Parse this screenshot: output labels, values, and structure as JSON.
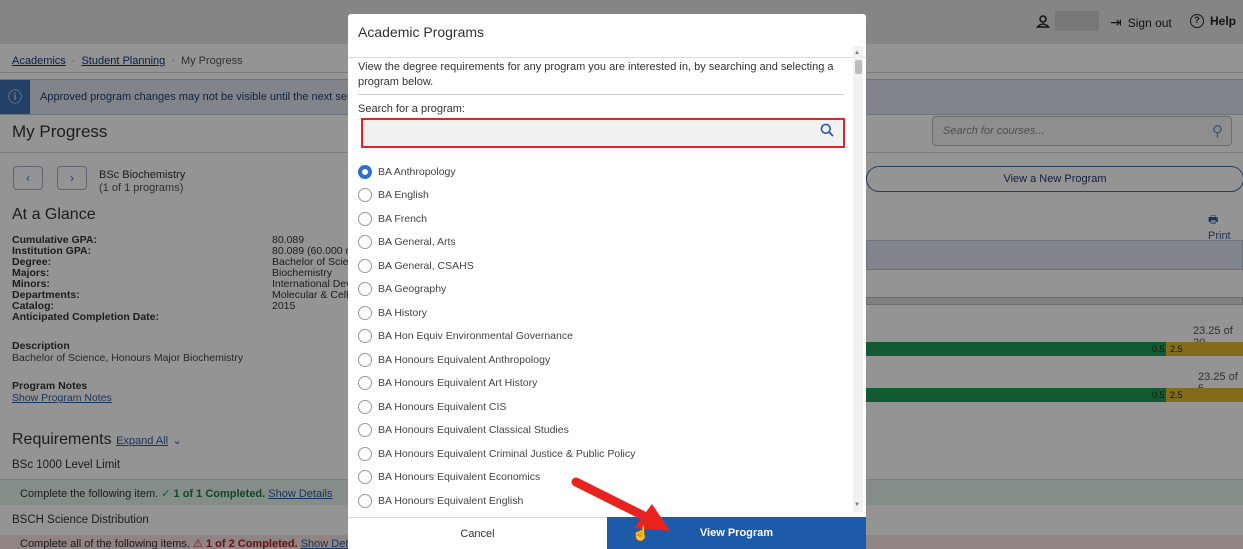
{
  "header": {
    "sign_out": "Sign out",
    "help": "Help"
  },
  "breadcrumb": {
    "items": [
      "Academics",
      "Student Planning",
      "My Progress"
    ]
  },
  "info_banner": {
    "text": "Approved program changes may not be visible until the next sem"
  },
  "page": {
    "title": "My Progress",
    "course_search_placeholder": "Search for courses...",
    "program_name": "BSc Biochemistry",
    "program_count": "(1 of 1 programs)",
    "view_new_program": "View a New Program",
    "print": "Print"
  },
  "glance": {
    "title": "At a Glance",
    "rows": [
      {
        "label": "Cumulative GPA:",
        "value": "80.089"
      },
      {
        "label": "Institution GPA:",
        "value": "80.089 (60.000 re"
      },
      {
        "label": "Degree:",
        "value": "Bachelor of Scien"
      },
      {
        "label": "Majors:",
        "value": "Biochemistry"
      },
      {
        "label": "Minors:",
        "value": "International Dev"
      },
      {
        "label": "Departments:",
        "value": "Molecular & Cellu"
      },
      {
        "label": "Catalog:",
        "value": "2015"
      },
      {
        "label": "Anticipated Completion Date:",
        "value": ""
      }
    ],
    "description_label": "Description",
    "description_value": "Bachelor of Science, Honours Major Biochemistry",
    "notes_label": "Program Notes",
    "notes_link": "Show Program Notes"
  },
  "progress": {
    "bar1_label": "23.25 of 20",
    "bar2_label": "23.25 of 5",
    "seg_a": "0.5",
    "seg_b": "2.5"
  },
  "requirements": {
    "title": "Requirements",
    "expand_all": "Expand All",
    "group1": "BSc 1000 Level Limit",
    "row1_text": "Complete the following item.",
    "row1_status": "1 of 1 Completed.",
    "row1_link": "Show Details",
    "group2": "BSCH Science Distribution",
    "row2_text": "Complete all of the following items.",
    "row2_status": "1 of 2 Completed.",
    "row2_link": "Show Details"
  },
  "modal": {
    "title": "Academic Programs",
    "description": "View the degree requirements for any program you are interested in, by searching and selecting a program below.",
    "search_label": "Search for a program:",
    "search_value": "",
    "selected_index": 0,
    "programs": [
      "BA Anthropology",
      "BA English",
      "BA French",
      "BA General, Arts",
      "BA General, CSAHS",
      "BA Geography",
      "BA History",
      "BA Hon Equiv Environmental Governance",
      "BA Honours Equivalent Anthropology",
      "BA Honours Equivalent Art History",
      "BA Honours Equivalent CIS",
      "BA Honours Equivalent Classical Studies",
      "BA Honours Equivalent Criminal Justice & Public Policy",
      "BA Honours Equivalent Economics",
      "BA Honours Equivalent English"
    ],
    "cancel_label": "Cancel",
    "view_label": "View Program"
  },
  "colors": {
    "accent": "#1d5aa9",
    "search_highlight": "#e0242b",
    "annotation_arrow": "#e8231f",
    "progress_green": "#1f9d57",
    "progress_yellow": "#e4b92f"
  }
}
